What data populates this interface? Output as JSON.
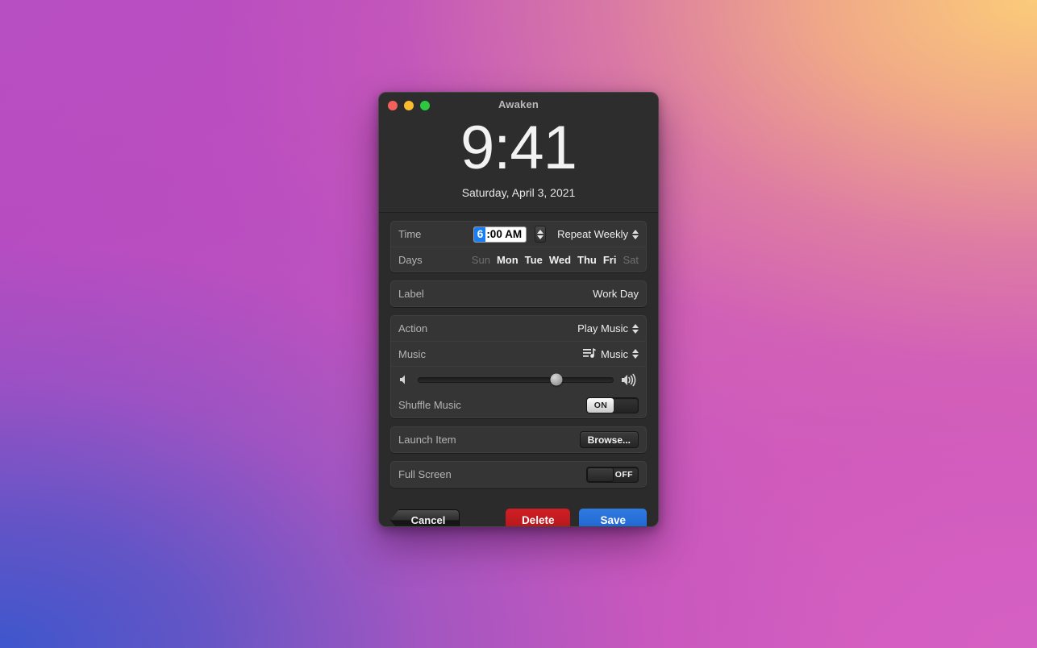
{
  "window": {
    "title": "Awaken",
    "traffic_lights": [
      {
        "name": "close",
        "color": "#f4605a"
      },
      {
        "name": "minimize",
        "color": "#f9bd2e"
      },
      {
        "name": "zoom",
        "color": "#2bc840"
      }
    ]
  },
  "clock": {
    "time": "9:41",
    "date": "Saturday, April 3, 2021"
  },
  "time_section": {
    "time_label": "Time",
    "time_value_selected": "6",
    "time_value_rest": ":00 AM",
    "repeat_value": "Repeat Weekly",
    "days_label": "Days",
    "days": [
      {
        "abbr": "Sun",
        "enabled": false
      },
      {
        "abbr": "Mon",
        "enabled": true
      },
      {
        "abbr": "Tue",
        "enabled": true
      },
      {
        "abbr": "Wed",
        "enabled": true
      },
      {
        "abbr": "Thu",
        "enabled": true
      },
      {
        "abbr": "Fri",
        "enabled": true
      },
      {
        "abbr": "Sat",
        "enabled": false
      }
    ]
  },
  "label_section": {
    "label": "Label",
    "value": "Work Day"
  },
  "action_section": {
    "action_label": "Action",
    "action_value": "Play Music",
    "music_label": "Music",
    "music_value": "Music",
    "music_icon": "playlist-icon",
    "volume": {
      "low_icon": "speaker-low-icon",
      "high_icon": "speaker-high-icon",
      "percent": 71
    },
    "shuffle_label": "Shuffle Music",
    "shuffle_state": "ON"
  },
  "launch_section": {
    "label": "Launch Item",
    "browse_label": "Browse..."
  },
  "fullscreen_section": {
    "label": "Full Screen",
    "state": "OFF"
  },
  "footer": {
    "cancel_label": "Cancel",
    "delete_label": "Delete",
    "save_label": "Save"
  },
  "colors": {
    "accent_blue": "#1f63d2",
    "delete_red": "#b3161c",
    "selection_blue": "#1a7ef2",
    "window_bg": "#2b2b2b",
    "panel_bg": "#353535"
  }
}
